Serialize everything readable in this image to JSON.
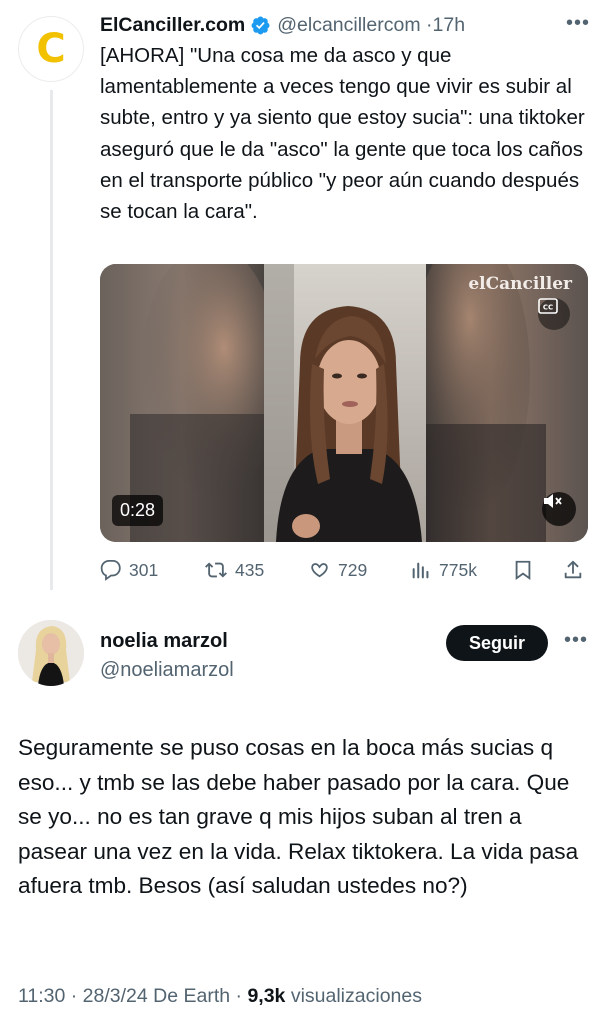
{
  "quoted_tweet": {
    "avatar_letter": "C",
    "name": "ElCanciller.com",
    "handle": "@elcancillercom",
    "separator": "·",
    "time": "17h",
    "more_icon": "more-horizontal-icon",
    "text": "[AHORA] \"Una cosa me da asco y que lamentablemente a veces tengo que vivir es subir al subte, entro y ya siento que estoy sucia\": una tiktoker aseguró que le da \"asco\" la gente que toca los caños en el transporte público \"y peor aún cuando después se tocan la cara\".",
    "video": {
      "duration": "0:28",
      "watermark": "elCanciller",
      "mute_icon": "speaker-muted-icon",
      "captions_icon": "captions-icon"
    },
    "stats": {
      "replies": "301",
      "retweets": "435",
      "likes": "729",
      "views": "775k"
    }
  },
  "reply": {
    "name": "noelia marzol",
    "handle": "@noeliamarzol",
    "follow_label": "Seguir",
    "text": "Seguramente se puso cosas en la boca más sucias q eso... y tmb se las debe haber pasado por la cara. Que se yo... no es tan grave q mis hijos suban al tren a pasear una vez en la vida. Relax tiktokera. La vida pasa afuera tmb. Besos (así saludan ustedes no?)",
    "meta": {
      "time": "11:30 · 28/3/24 De Earth ·",
      "views_count": "9,3k",
      "views_label": "visualizaciones"
    }
  },
  "colors": {
    "text_primary": "#0f1419",
    "text_secondary": "#536471",
    "verified_blue": "#1d9bf0",
    "logo_yellow": "#f2c100",
    "follow_button_bg": "#0f1419"
  }
}
